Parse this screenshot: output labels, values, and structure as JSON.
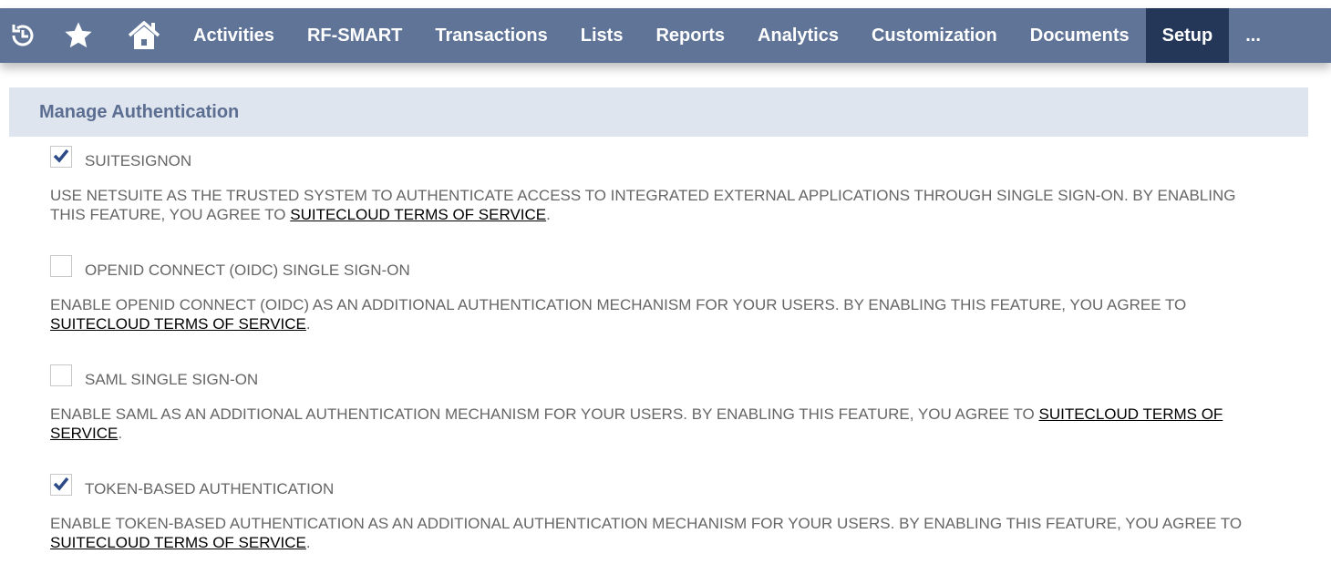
{
  "nav": {
    "icons": [
      "recent-icon",
      "star-icon",
      "home-icon"
    ],
    "items": [
      "Activities",
      "RF-SMART",
      "Transactions",
      "Lists",
      "Reports",
      "Analytics",
      "Customization",
      "Documents",
      "Setup",
      "..."
    ],
    "active": "Setup"
  },
  "header": {
    "title": "Manage Authentication"
  },
  "features": [
    {
      "label": "SUITESIGNON",
      "checked": true,
      "desc": "USE NETSUITE AS THE TRUSTED SYSTEM TO AUTHENTICATE ACCESS TO INTEGRATED EXTERNAL APPLICATIONS THROUGH SINGLE SIGN-ON. BY ENABLING THIS FEATURE, YOU AGREE TO ",
      "link": "SUITECLOUD TERMS OF SERVICE",
      "end": "."
    },
    {
      "label": "OPENID CONNECT (OIDC) SINGLE SIGN-ON",
      "checked": false,
      "desc": "ENABLE OPENID CONNECT (OIDC) AS AN ADDITIONAL AUTHENTICATION MECHANISM FOR YOUR USERS. BY ENABLING THIS FEATURE, YOU AGREE TO ",
      "link": "SUITECLOUD TERMS OF SERVICE",
      "end": "."
    },
    {
      "label": "SAML SINGLE SIGN-ON",
      "checked": false,
      "desc": "ENABLE SAML AS AN ADDITIONAL AUTHENTICATION MECHANISM FOR YOUR USERS. BY ENABLING THIS FEATURE, YOU AGREE TO ",
      "link": "SUITECLOUD TERMS OF SERVICE",
      "end": "."
    },
    {
      "label": "TOKEN-BASED AUTHENTICATION",
      "checked": true,
      "desc": "ENABLE TOKEN-BASED AUTHENTICATION AS AN ADDITIONAL AUTHENTICATION MECHANISM FOR YOUR USERS. BY ENABLING THIS FEATURE, YOU AGREE TO ",
      "link": "SUITECLOUD TERMS OF SERVICE",
      "end": "."
    }
  ],
  "colors": {
    "nav": "#5f7497",
    "active": "#243759",
    "header": "#dfe5ef",
    "check": "#2b4a86"
  }
}
